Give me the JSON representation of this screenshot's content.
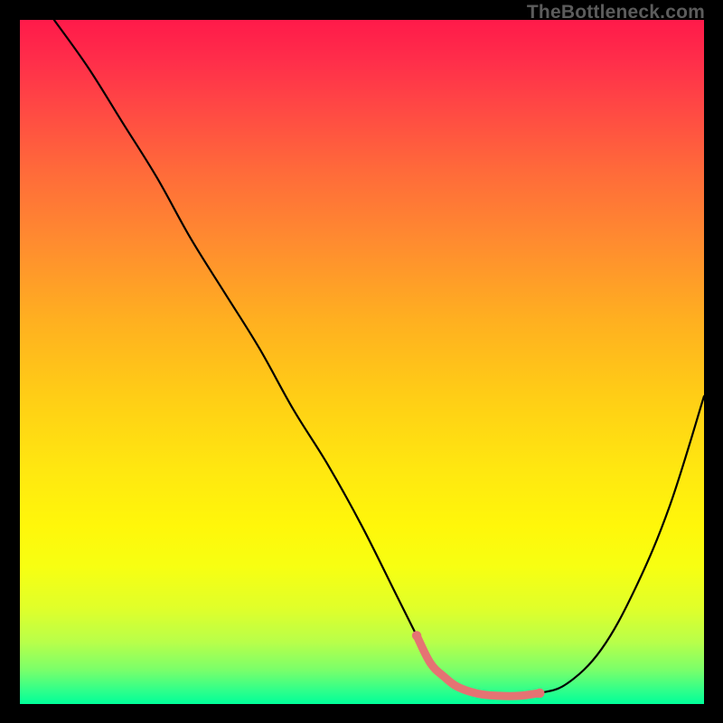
{
  "watermark": "TheBottleneck.com",
  "colors": {
    "page_bg": "#000000",
    "curve": "#000000",
    "accent_segment": "#e57373",
    "watermark": "#5c5c5c",
    "gradient_top": "#ff1a4a",
    "gradient_bottom": "#00ff9a"
  },
  "chart_data": {
    "type": "line",
    "title": "",
    "xlabel": "",
    "ylabel": "",
    "xlim": [
      0,
      100
    ],
    "ylim": [
      0,
      100
    ],
    "grid": false,
    "legend": false,
    "annotations": [],
    "series": [
      {
        "name": "bottleneck-curve",
        "note": "y is percentage from bottom (0) to top (100), x is percentage from left (0) to right (100); estimated from pixel positions",
        "x": [
          5,
          10,
          15,
          20,
          25,
          30,
          35,
          40,
          45,
          50,
          55,
          58,
          60,
          62,
          64,
          67,
          70,
          73,
          76,
          80,
          85,
          90,
          95,
          100
        ],
        "y": [
          100,
          93,
          85,
          77,
          68,
          60,
          52,
          43,
          35,
          26,
          16,
          10,
          6,
          4,
          2.5,
          1.5,
          1.2,
          1.2,
          1.6,
          3,
          8,
          17,
          29,
          45
        ]
      }
    ],
    "highlight_segment": {
      "note": "salmon-colored thicker portion of curve near the bottom",
      "x_start": 58,
      "x_end": 79
    },
    "background": {
      "type": "vertical-gradient",
      "stops": [
        {
          "pos": 0,
          "color": "#ff1a4a"
        },
        {
          "pos": 50,
          "color": "#ffd015"
        },
        {
          "pos": 80,
          "color": "#fff70a"
        },
        {
          "pos": 100,
          "color": "#00ff9a"
        }
      ]
    }
  }
}
